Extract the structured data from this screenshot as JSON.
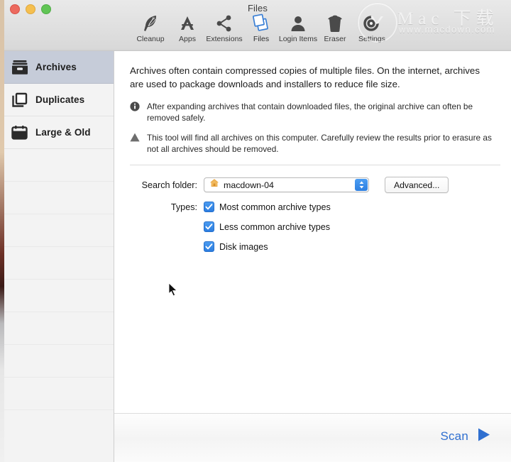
{
  "window": {
    "title": "Files",
    "traffic_lights": [
      {
        "name": "close",
        "color": "#ec6a5f"
      },
      {
        "name": "minimize",
        "color": "#f5bf4f"
      },
      {
        "name": "zoom",
        "color": "#61c555"
      }
    ]
  },
  "toolbar": {
    "items": [
      {
        "label": "Cleanup",
        "icon": "feather-icon",
        "active": false
      },
      {
        "label": "Apps",
        "icon": "app-store-icon",
        "active": false
      },
      {
        "label": "Extensions",
        "icon": "share-nodes-icon",
        "active": false
      },
      {
        "label": "Files",
        "icon": "files-icon",
        "active": true
      },
      {
        "label": "Login Items",
        "icon": "user-icon",
        "active": false
      },
      {
        "label": "Eraser",
        "icon": "trash-icon",
        "active": false
      },
      {
        "label": "Settings",
        "icon": "eye-gear-icon",
        "active": false
      }
    ],
    "active_color": "#3a7fd5"
  },
  "watermark": {
    "brand": "Mac 下载",
    "url": "www.macdown.com"
  },
  "sidebar": {
    "items": [
      {
        "label": "Archives",
        "icon": "archive-box-icon",
        "selected": true
      },
      {
        "label": "Duplicates",
        "icon": "duplicate-icon",
        "selected": false
      },
      {
        "label": "Large & Old",
        "icon": "calendar-icon",
        "selected": false
      }
    ],
    "empty_row_count": 8,
    "selected_color": "#c6ccd9"
  },
  "main": {
    "intro": "Archives often contain compressed copies of multiple files. On the internet, archives are used to package downloads and installers to reduce file size.",
    "notes": [
      {
        "icon": "info-icon",
        "text": "After expanding archives that contain downloaded files, the original archive can often be removed safely."
      },
      {
        "icon": "warning-icon",
        "text": "This tool will find all archives on this computer. Carefully review the results prior to erasure as not all archives should be removed."
      }
    ],
    "search_folder": {
      "label": "Search folder:",
      "icon": "home-icon",
      "value": "macdown-04",
      "advanced_label": "Advanced..."
    },
    "types": {
      "label": "Types:",
      "options": [
        {
          "label": "Most common archive types",
          "checked": true
        },
        {
          "label": "Less common archive types",
          "checked": true
        },
        {
          "label": "Disk images",
          "checked": true
        }
      ]
    }
  },
  "footer": {
    "scan_label": "Scan",
    "scan_icon": "play-triangle-icon",
    "accent_color": "#2f6fd0"
  }
}
